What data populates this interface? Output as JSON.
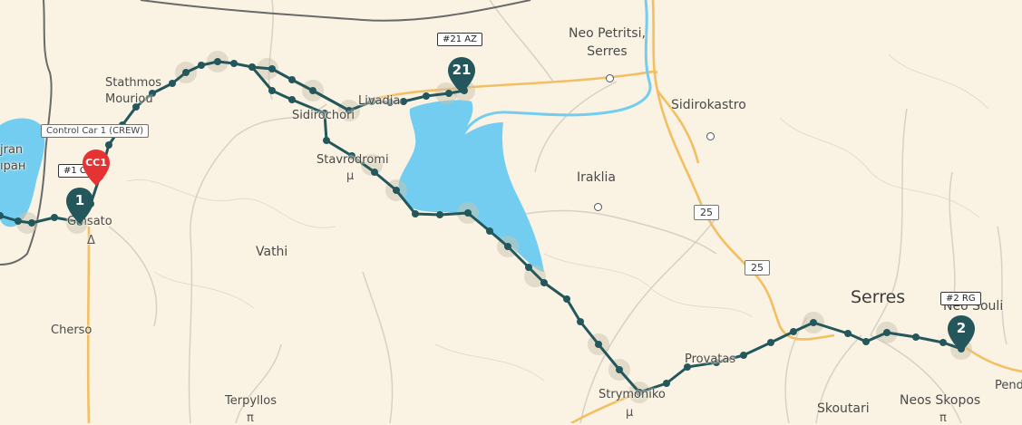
{
  "places": {
    "neo_petritsi": "Neo Petritsi,\nSerres",
    "sidirokastro": "Sidirokastro",
    "iraklia": "Iraklia",
    "serres": "Serres",
    "neo_souli": "Neo Souli",
    "neos_skopos": "Neos Skopos",
    "skoutari": "Skoutari",
    "strymoniko": "Strymoniko",
    "provatas": "Provatas",
    "vathi": "Vathi",
    "cherso": "Cherso",
    "terpyllos": "Terpyllos",
    "stathmos_mouriou": "Stathmos\nMouriou",
    "sidirokastro_lake": "Sidirochori",
    "livadia": "Livadia",
    "stavrodromi": "Stavrodromi",
    "kilkis_side_a": "jran",
    "kilkis_side_b": "ıран",
    "gyp": "Ginsato",
    "pen": "Pend",
    "greek_mu": "μ",
    "greek_delta": "Δ",
    "greek_pi": "π"
  },
  "road_shields": [
    "25",
    "25"
  ],
  "tags": {
    "control_car": "Control Car 1 (CREW)",
    "car_1": "#1 CS",
    "car_21": "#21 AZ",
    "car_2": "#2 RG"
  },
  "markers": {
    "m1": "1",
    "m21": "21",
    "m2": "2",
    "red": "CC1"
  },
  "colors": {
    "background": "#faf3e3",
    "water": "#72cdf1",
    "route": "#23575b",
    "route_halo": "#c9c3af",
    "major_road": "#f2bf63",
    "border": "#5b5b5b",
    "marker_red": "#e53232"
  }
}
